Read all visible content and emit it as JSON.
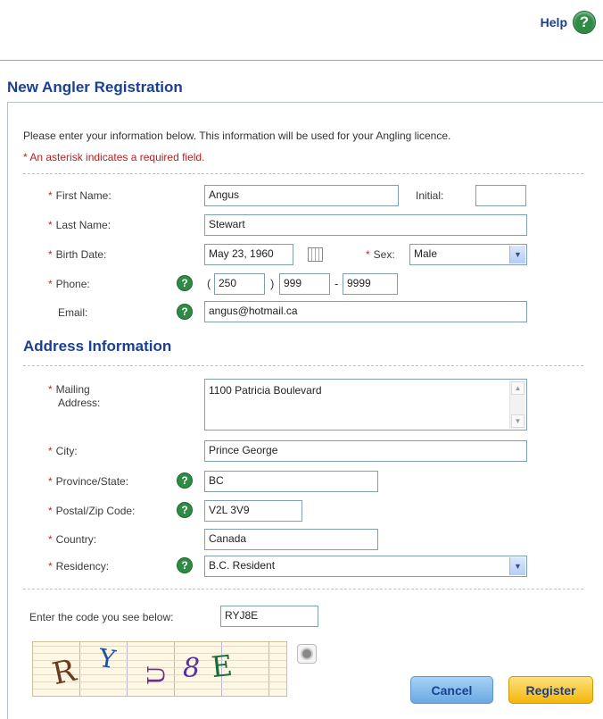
{
  "header": {
    "help_label": "Help",
    "help_icon": "?"
  },
  "page": {
    "title": "New Angler Registration"
  },
  "intro": {
    "text": "Please enter your information below. This information will be used for your Angling licence.",
    "required_note": "* An asterisk indicates a required field."
  },
  "required_mark": "*",
  "help_glyph": "?",
  "fields": {
    "first_name": {
      "label": "First Name:",
      "value": "Angus"
    },
    "initial": {
      "label": "Initial:",
      "value": ""
    },
    "last_name": {
      "label": "Last Name:",
      "value": "Stewart"
    },
    "birth_date": {
      "label": "Birth Date:",
      "value": "May 23, 1960"
    },
    "sex": {
      "label": "Sex:",
      "value": "Male"
    },
    "phone": {
      "label": "Phone:",
      "area": "250",
      "prefix": "999",
      "line": "9999",
      "open_paren": "(",
      "close_paren": ")",
      "dash": "-"
    },
    "email": {
      "label": "Email:",
      "value": "angus@hotmail.ca"
    }
  },
  "address": {
    "section_title": "Address Information",
    "mailing": {
      "label_line1": "Mailing",
      "label_line2": "Address:",
      "value": "1100 Patricia Boulevard"
    },
    "city": {
      "label": "City:",
      "value": "Prince George"
    },
    "province": {
      "label": "Province/State:",
      "value": "BC"
    },
    "postal": {
      "label": "Postal/Zip Code:",
      "value": "V2L 3V9"
    },
    "country": {
      "label": "Country:",
      "value": "Canada"
    },
    "residency": {
      "label": "Residency:",
      "value": "B.C. Resident"
    }
  },
  "captcha": {
    "prompt": "Enter the code you see below:",
    "value": "RYJ8E",
    "image_text": [
      "R",
      "Y",
      "U",
      "8",
      "E"
    ]
  },
  "buttons": {
    "cancel": "Cancel",
    "register": "Register"
  },
  "colors": {
    "title_blue": "#1c3f94",
    "required_red": "#c0272d",
    "help_green": "#2f8a45",
    "cancel_blue": "#7db7ea",
    "register_yellow": "#f6c21c"
  }
}
